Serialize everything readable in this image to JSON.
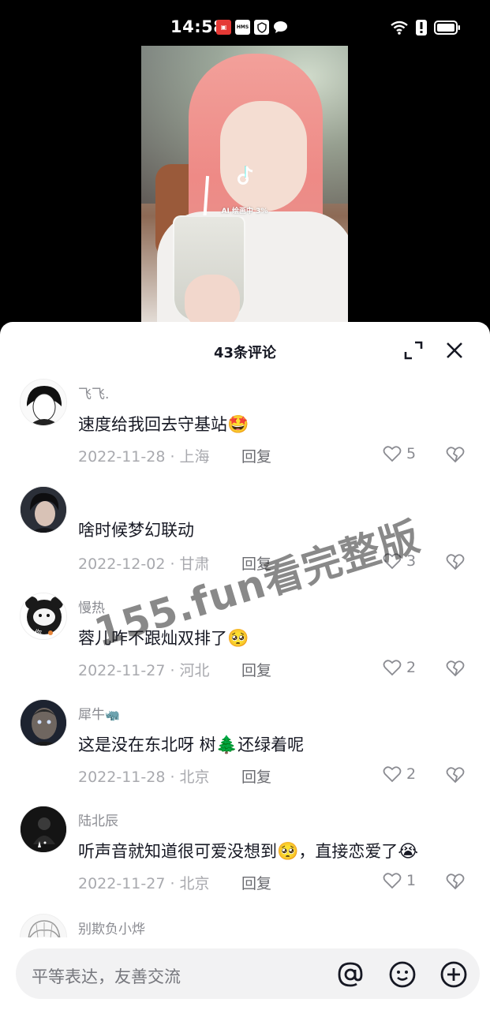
{
  "status_bar": {
    "time": "14:58",
    "notifications": [
      {
        "icon": "app-notification-icon",
        "label": "",
        "color": "#e53935"
      },
      {
        "icon": "hms-icon",
        "label": "HMS"
      },
      {
        "icon": "shield-app-icon",
        "label": ""
      },
      {
        "icon": "message-bubble-icon",
        "label": ""
      }
    ],
    "right_icons": [
      "wifi-icon",
      "alert-icon",
      "battery-icon"
    ]
  },
  "video": {
    "ai_progress": "AI 绘画中 3%",
    "logo_icon": "tiktok-logo-icon"
  },
  "sheet": {
    "title": "43条评论",
    "expand_icon": "expand-icon",
    "close_icon": "close-icon"
  },
  "comments": [
    {
      "user": "飞飞.",
      "text": "速度给我回去守基站",
      "emoji": "🤩",
      "date": "2022-11-28 · 上海",
      "reply": "回复",
      "likes": "5"
    },
    {
      "user": "",
      "text": "啥时候梦幻联动",
      "emoji": "",
      "date": "2022-12-02 · 甘肃",
      "reply": "回复",
      "likes": "3"
    },
    {
      "user": "慢热",
      "text": "蓉儿咋不跟灿双排了",
      "emoji": "🥺",
      "date": "2022-11-27 · 河北",
      "reply": "回复",
      "likes": "2"
    },
    {
      "user": "犀牛",
      "user_emoji": "🦏",
      "text": "这是没在东北呀   树",
      "text_emoji": "🌲",
      "text_after": "还绿着呢",
      "date": "2022-11-28 · 北京",
      "reply": "回复",
      "likes": "2"
    },
    {
      "user": "陆北辰",
      "text": "听声音就知道很可爱没想到",
      "text_emoji": "🥺",
      "text_after": "，直接恋爱了",
      "emoji": "😭",
      "date": "2022-11-27 · 北京",
      "reply": "回复",
      "likes": "1"
    },
    {
      "user": "别欺负小烨",
      "text": "",
      "date": "",
      "reply": "",
      "likes": ""
    }
  ],
  "input": {
    "placeholder": "平等表达，友善交流",
    "icons": [
      "at-icon",
      "emoji-icon",
      "add-icon"
    ]
  },
  "watermark": "155.fun看完整版",
  "colors": {
    "sheet_bg": "#ffffff",
    "title_text": "#161823",
    "meta_text": "#a8a9ae",
    "input_bg": "#f2f2f3"
  }
}
